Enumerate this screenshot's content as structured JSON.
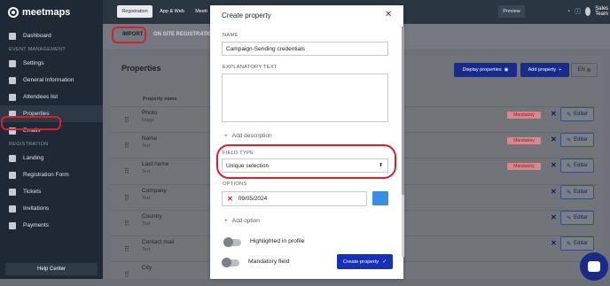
{
  "app": {
    "logo": "meetmaps"
  },
  "sidebar": {
    "dashboard": "Dashboard",
    "section_event": "EVENT MANAGEMENT",
    "settings": "Settings",
    "general": "General Information",
    "attendees": "Attendees list",
    "properties": "Properties",
    "emails": "Emails",
    "section_registration": "REGISTRATION",
    "landing": "Landing",
    "registration_form": "Registration Form",
    "tickets": "Tickets",
    "invitations": "Invitations",
    "payments": "Payments",
    "help": "Help Center"
  },
  "topbar": {
    "tabs": [
      "Registration",
      "App & Web",
      "Meeti"
    ],
    "preview": "Preview",
    "user": "Sales Team"
  },
  "subtabs": {
    "import": "IMPORT",
    "onsite": "ON SITE REGISTRATION"
  },
  "page": {
    "title": "Properties",
    "display_btn": "Display properties",
    "add_btn": "Add property",
    "lang": "EN",
    "col_name": "Property name",
    "mandatory": "Mandatory",
    "edit": "Editar",
    "rows": [
      {
        "name": "Photo",
        "type": "Image"
      },
      {
        "name": "Name",
        "type": "Text"
      },
      {
        "name": "Last name",
        "type": "Text"
      },
      {
        "name": "Company",
        "type": "Text"
      },
      {
        "name": "Country",
        "type": "Text"
      },
      {
        "name": "Contact mail",
        "type": "Text"
      },
      {
        "name": "City",
        "type": ""
      }
    ]
  },
  "modal": {
    "title": "Create property",
    "name_label": "NAME",
    "name_value": "Campaign-Sending credentials",
    "explanatory_label": "EXPLANATORY TEXT",
    "add_description": "Add description",
    "field_type_label": "FIELD TYPE",
    "field_type_value": "Unique selection",
    "options_label": "OPTIONS",
    "option_value": "09/05/2024",
    "option_color": "#3a8de0",
    "add_option": "Add option",
    "highlighted": "Highlighted in profile",
    "mandatory_field": "Mandatory field",
    "create_btn": "Create property"
  }
}
